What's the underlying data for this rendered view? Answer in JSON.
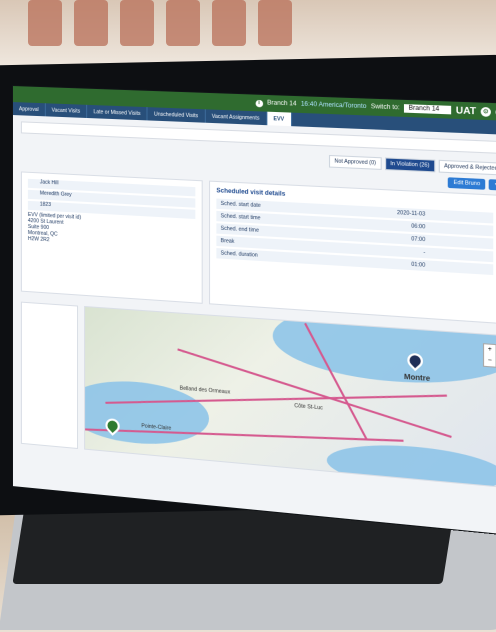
{
  "topbar": {
    "branch_label": "Branch 14",
    "timezone": "16:40 America/Toronto",
    "switch_label": "Switch to:",
    "branch_select": "Branch 14",
    "env": "UAT"
  },
  "tabs": [
    "Approval",
    "Vacant Visits",
    "Late or Missed Visits",
    "Unscheduled Visits",
    "Vacant Assignments",
    "EVV"
  ],
  "filters": {
    "not_approved": "Not Approved (0)",
    "in_violation": "In Violation (26)",
    "approved_rejected": "Approved & Rejected"
  },
  "edit_button": "Edit Bruno",
  "left_panel": {
    "lines": [
      "Jack Hill",
      "Meredith Grey",
      "1823",
      "EVV (limited per visit id)",
      "4200 St Laurent",
      "Suite 900",
      "Montreal, QC",
      "H2W 2R2"
    ]
  },
  "visit_details": {
    "title": "Scheduled visit details",
    "rows": [
      {
        "k": "Sched. start date",
        "v": "2020-11-03"
      },
      {
        "k": "Sched. start time",
        "v": "06:00"
      },
      {
        "k": "Sched. end time",
        "v": "07:00"
      },
      {
        "k": "Break",
        "v": "-"
      },
      {
        "k": "Sched. duration",
        "v": "01:00"
      }
    ]
  },
  "map": {
    "labels": [
      "Montre",
      "Belland des Ormeaux",
      "Pointe-Claire",
      "Côte St-Luc"
    ],
    "zoom_in": "+",
    "zoom_out": "−"
  },
  "colors": {
    "topbar": "#2f6b2f",
    "tabs": "#284f7a",
    "accent": "#1f4a8f"
  }
}
